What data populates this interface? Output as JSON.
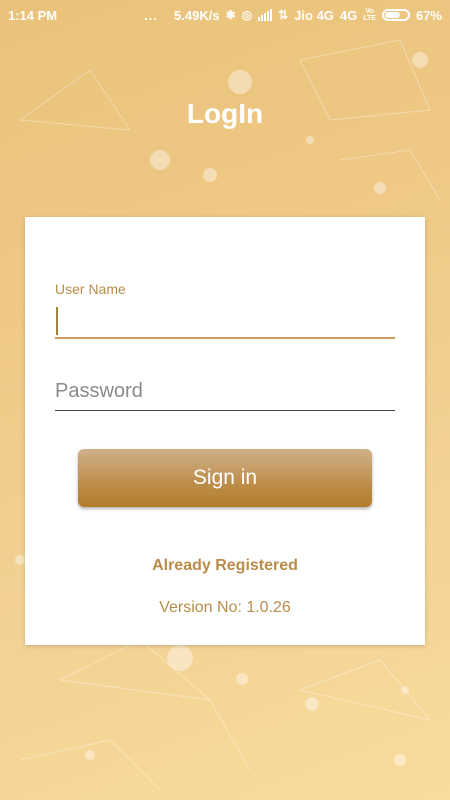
{
  "status_bar": {
    "time": "1:14 PM",
    "dots": "...",
    "speed": "5.49K/s",
    "carrier": "Jio 4G",
    "network": "4G",
    "volte_top": "Vo",
    "volte_bottom": "LTE",
    "battery": "67%",
    "icons": [
      "bluetooth-icon",
      "alarm-off-icon",
      "signal-icon",
      "data-transfer-icon",
      "battery-icon"
    ]
  },
  "page": {
    "title": "LogIn"
  },
  "form": {
    "username_label": "User Name",
    "username_value": "",
    "password_placeholder": "Password",
    "signin_label": "Sign in",
    "already_registered": "Already Registered",
    "version": "Version No: 1.0.26"
  },
  "colors": {
    "accent": "#b98c49",
    "button_top": "#d0b08a",
    "button_bottom": "#b37c2a",
    "background": "#efc985"
  }
}
